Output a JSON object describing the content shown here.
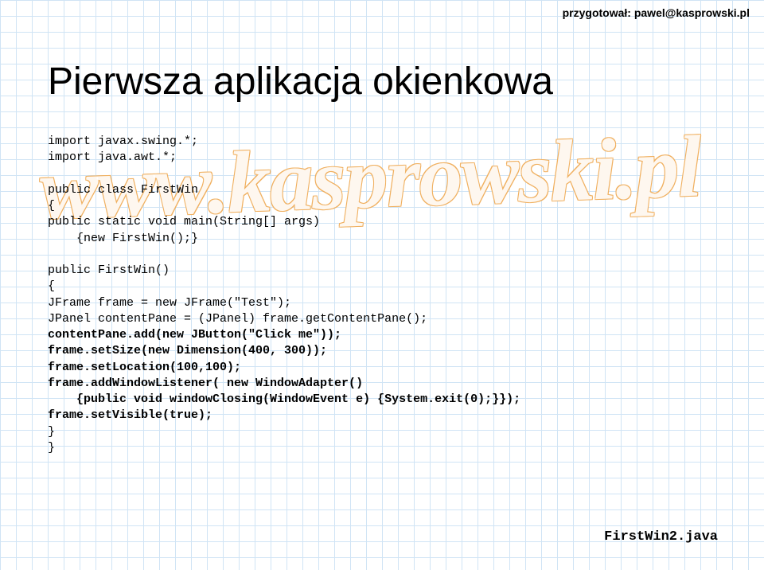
{
  "header": {
    "author_label": "przygotował: pawel@kasprowski.pl"
  },
  "watermark": "www.kasprowski.pl",
  "title": "Pierwsza aplikacja okienkowa",
  "code": {
    "l1": "import javax.swing.*;",
    "l2": "import java.awt.*;",
    "l3": "public class FirstWin",
    "l4": "{",
    "l5": "public static void main(String[] args)",
    "l6": "    {new FirstWin();}",
    "l7": "public FirstWin()",
    "l8": "{",
    "l9": "JFrame frame = new JFrame(\"Test\");",
    "l10": "JPanel contentPane = (JPanel) frame.getContentPane();",
    "l11": "contentPane.add(new JButton(\"Click me\"));",
    "l12": "frame.setSize(new Dimension(400, 300));",
    "l13": "frame.setLocation(100,100);",
    "l14": "frame.addWindowListener( new WindowAdapter()",
    "l15": "    {public void windowClosing(WindowEvent e) {System.exit(0);}});",
    "l16": "frame.setVisible(true);",
    "l17": "}",
    "l18": "}"
  },
  "filename": "FirstWin2.java"
}
